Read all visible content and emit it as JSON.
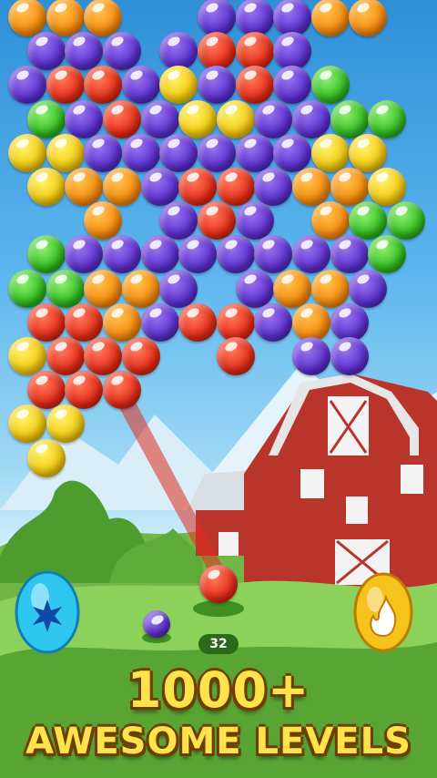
{
  "game": {
    "moves_left": "32",
    "promo_line1": "1000+",
    "promo_line2": "AWESOME LEVELS"
  },
  "colors": {
    "orange": "#f58a0b",
    "purple": "#5b2fcf",
    "red": "#e52b16",
    "yellow": "#f2c80b",
    "green": "#2fbb1f"
  },
  "grid": {
    "rows": [
      "O.O.O.....P.P.P.O.O.",
      ".P.P.P..P.R.R.P.....",
      "P.R.R.P.Y.P.R.P.G...",
      ".G.P.R.P.Y.Y.P.P.G.G",
      "Y.Y.P.P.P.P.P.P.Y.Y.",
      ".Y.O.O.P.R.R.P.O.O.Y",
      "....O...P.R.P...O.G.G",
      ".G.P.P.P.P.P.P.P.P.G",
      "G.G.O.O.P...P.O.O.P.",
      ".R.R.O.P.R.R.P.O.P..",
      "Y.R.R.R....R...P.P..",
      ".R.R.R..............",
      "Y.Y.................",
      ".Y.................."
    ]
  },
  "shooter": {
    "current_bubble": "red",
    "next_bubble": "purple",
    "aim_angle_deg": -38
  },
  "boosters": {
    "left": "blue-star-egg",
    "right": "fire-egg"
  }
}
